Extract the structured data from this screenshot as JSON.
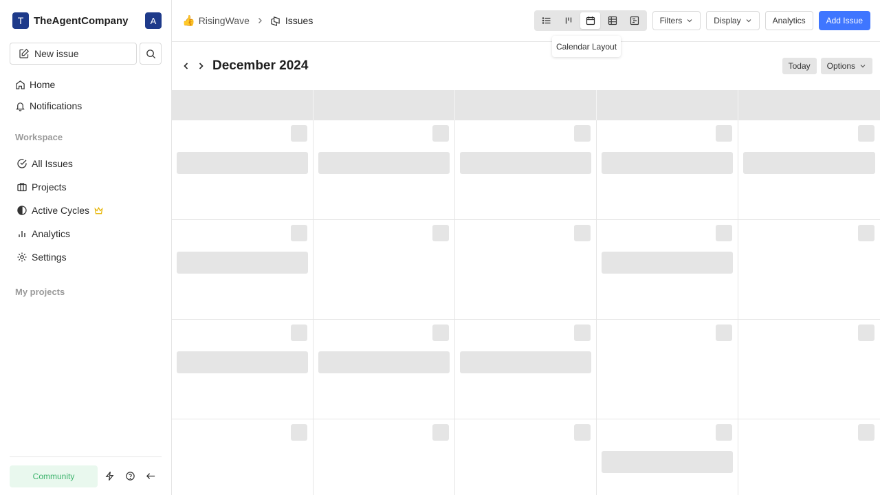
{
  "workspace": {
    "initial": "T",
    "name": "TheAgentCompany",
    "user_initial": "A",
    "brand_color": "#1e3a8a"
  },
  "sidebar": {
    "new_issue_label": "New issue",
    "items": [
      {
        "label": "Home",
        "icon": "home-icon"
      },
      {
        "label": "Notifications",
        "icon": "bell-icon"
      }
    ],
    "workspace_title": "Workspace",
    "workspace_items": [
      {
        "label": "All Issues",
        "icon": "check-circle-icon"
      },
      {
        "label": "Projects",
        "icon": "briefcase-icon"
      },
      {
        "label": "Active Cycles",
        "icon": "contrast-icon",
        "badge_icon": "crown-icon"
      },
      {
        "label": "Analytics",
        "icon": "bar-chart-icon"
      },
      {
        "label": "Settings",
        "icon": "gear-icon"
      }
    ],
    "projects_title": "My projects",
    "community_label": "Community"
  },
  "header": {
    "project_emoji": "👍",
    "project_name": "RisingWave",
    "current_page": "Issues",
    "layouts": [
      "list-layout-icon",
      "kanban-layout-icon",
      "calendar-layout-icon",
      "spreadsheet-layout-icon",
      "gantt-layout-icon"
    ],
    "active_layout": "calendar-layout-icon",
    "tooltip": "Calendar Layout",
    "filters_label": "Filters",
    "display_label": "Display",
    "analytics_label": "Analytics",
    "add_issue_label": "Add Issue",
    "accent_color": "#3f76ff"
  },
  "calendar": {
    "month_label": "December 2024",
    "today_label": "Today",
    "options_label": "Options",
    "rows": [
      [
        true,
        true,
        true,
        true,
        true
      ],
      [
        true,
        false,
        false,
        true,
        false
      ],
      [
        true,
        true,
        true,
        false,
        false
      ],
      [
        false,
        false,
        false,
        true,
        false
      ]
    ]
  }
}
